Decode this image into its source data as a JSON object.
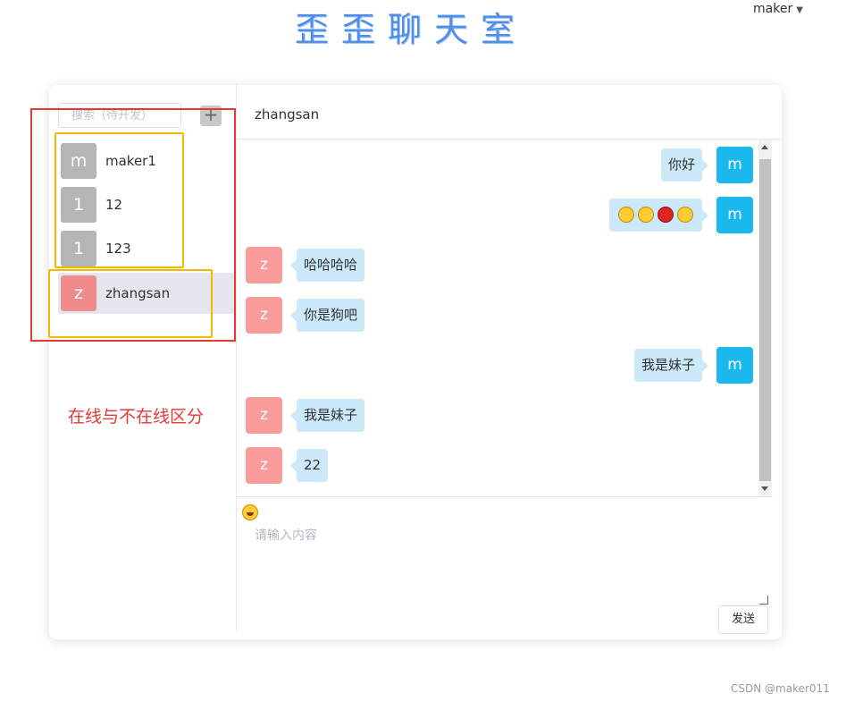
{
  "app": {
    "title": "歪歪聊天室"
  },
  "user_menu": {
    "username": "maker",
    "caret_icon": "caret-down-icon"
  },
  "sidebar": {
    "search": {
      "placeholder": "搜索（待开发）",
      "value": ""
    },
    "add_button_label": "+",
    "contacts": [
      {
        "initial": "m",
        "name": "maker1",
        "avatar_color": "#b5b5b5",
        "active": false
      },
      {
        "initial": "1",
        "name": "12",
        "avatar_color": "#b5b5b5",
        "active": false
      },
      {
        "initial": "1",
        "name": "123",
        "avatar_color": "#b5b5b5",
        "active": false
      },
      {
        "initial": "z",
        "name": "zhangsan",
        "avatar_color": "#f08b8b",
        "active": true
      }
    ]
  },
  "annotation": {
    "text": "在线与不在线区分"
  },
  "chat": {
    "header_title": "zhangsan",
    "messages": [
      {
        "side": "right",
        "initial": "m",
        "text": "你好"
      },
      {
        "side": "right",
        "initial": "m",
        "text": "",
        "emojis": [
          "smirk-emoji-icon",
          "confused-emoji-icon",
          "devil-emoji-icon",
          "unamused-emoji-icon"
        ]
      },
      {
        "side": "left",
        "initial": "z",
        "text": "哈哈哈哈"
      },
      {
        "side": "left",
        "initial": "z",
        "text": "你是狗吧"
      },
      {
        "side": "right",
        "initial": "m",
        "text": "我是妹子"
      },
      {
        "side": "left",
        "initial": "z",
        "text": "我是妹子"
      },
      {
        "side": "left",
        "initial": "z",
        "text": "22"
      }
    ],
    "self_avatar_color": "#1ab8ee",
    "other_avatar_color": "#f79b9b",
    "bubble_color": "#cce9f9"
  },
  "composer": {
    "emoji_button_icon": "grinning-emoji-icon",
    "placeholder": "请输入内容",
    "value": "",
    "send_label": "发送"
  },
  "watermark": "CSDN @maker011",
  "colors": {
    "accent": "#4f8fe8",
    "annotation_red": "#e53935",
    "annotation_yellow": "#f5b800"
  }
}
